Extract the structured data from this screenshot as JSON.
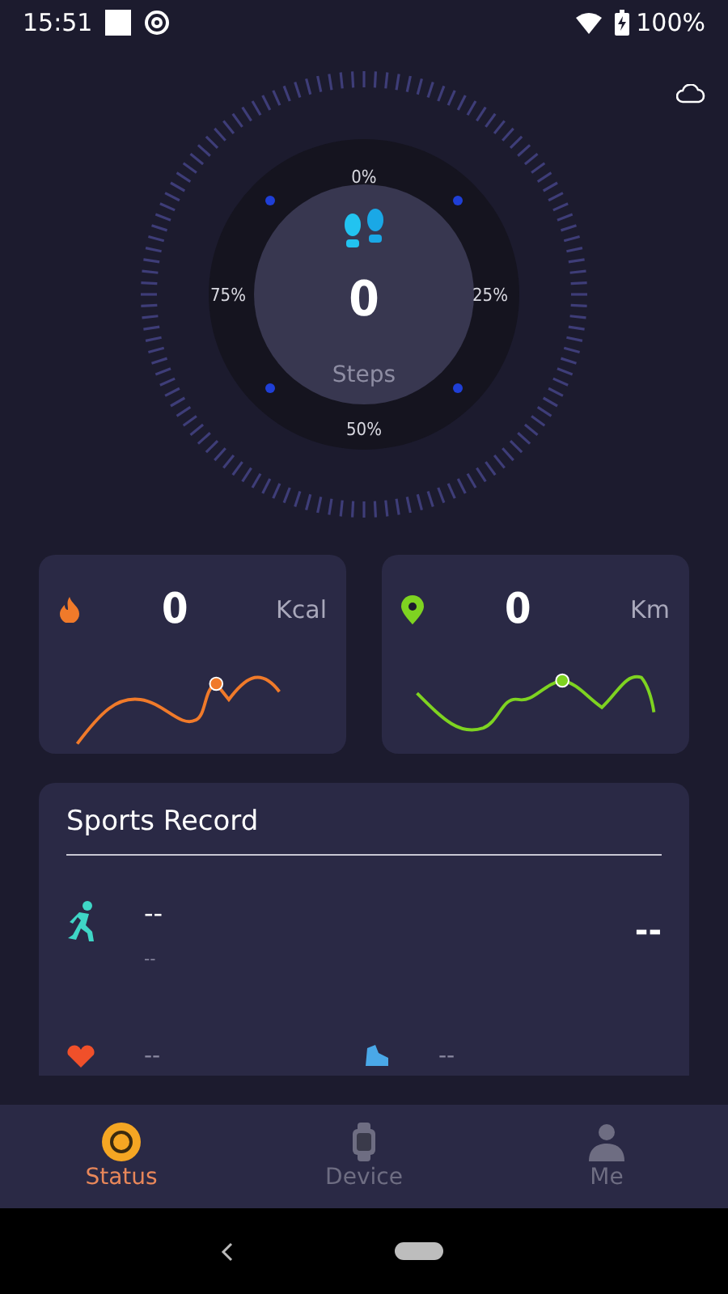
{
  "status_bar": {
    "time": "15:51",
    "battery": "100%"
  },
  "gauge": {
    "labels": [
      {
        "kind": "top",
        "text": "0%"
      },
      {
        "kind": "right",
        "text": "25%"
      },
      {
        "kind": "bottom",
        "text": "50%"
      },
      {
        "kind": "left",
        "text": "75%"
      }
    ],
    "value": "0",
    "unit": "Steps"
  },
  "stat_cards": [
    {
      "kind": "calories",
      "value": "0",
      "unit": "Kcal",
      "color": "#f07a2a"
    },
    {
      "kind": "distance",
      "value": "0",
      "unit": "Km",
      "color": "#7ed321"
    }
  ],
  "sports_record": {
    "title": "Sports Record",
    "main": {
      "title": "--",
      "subtitle": "--",
      "value": "--"
    },
    "items": [
      {
        "kind": "heart",
        "value": "--"
      },
      {
        "kind": "shoe",
        "value": "--"
      }
    ]
  },
  "tabs": [
    {
      "kind": "status",
      "label": "Status",
      "selected": true
    },
    {
      "kind": "device",
      "label": "Device",
      "selected": false
    },
    {
      "kind": "me",
      "label": "Me",
      "selected": false
    }
  ]
}
